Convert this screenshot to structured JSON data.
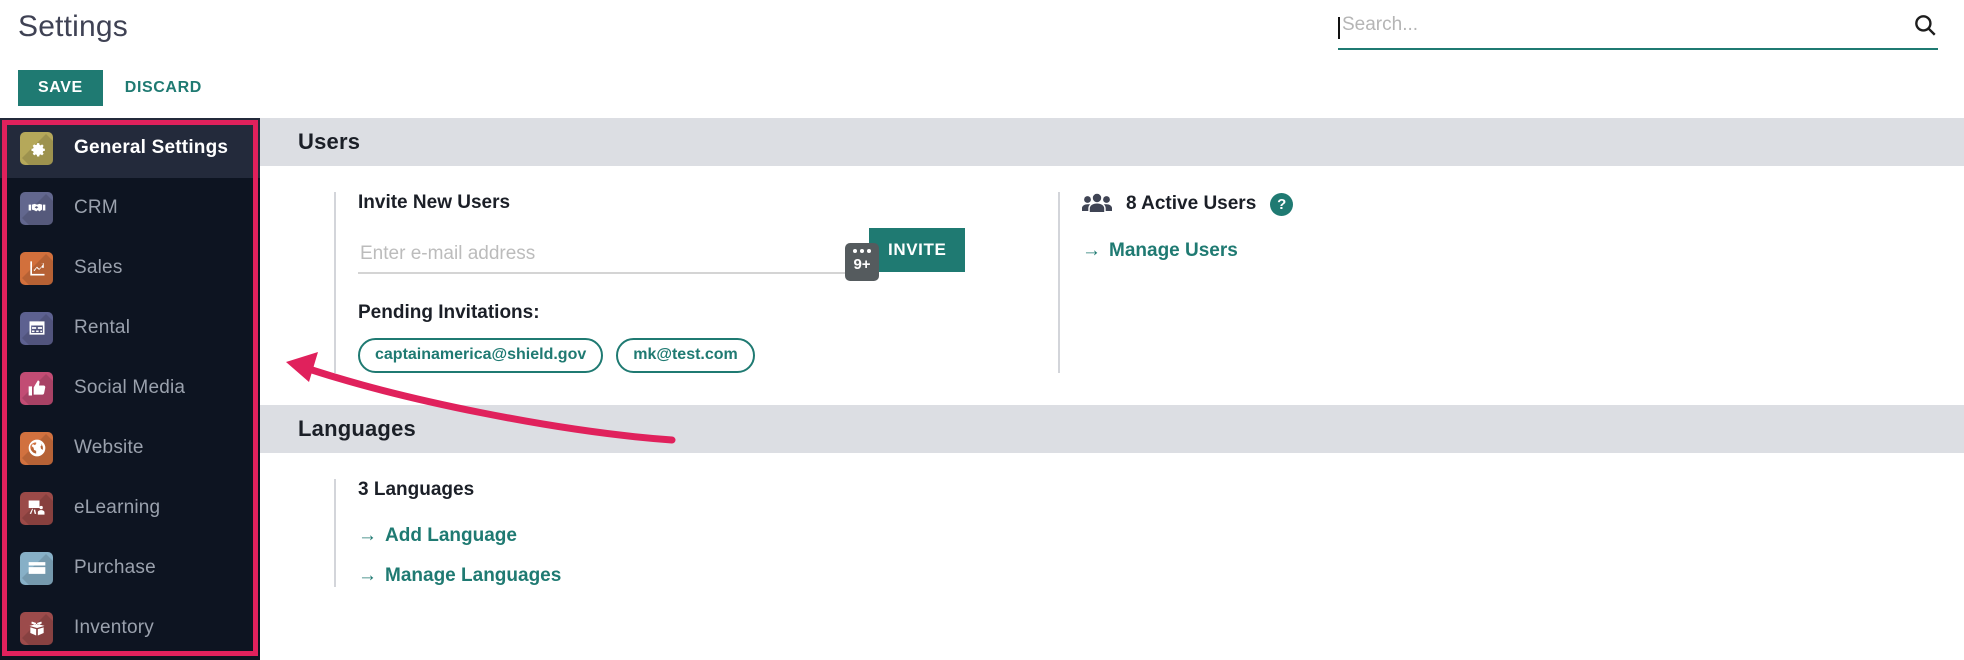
{
  "header": {
    "title": "Settings",
    "save_label": "SAVE",
    "discard_label": "DISCARD"
  },
  "search": {
    "placeholder": "Search...",
    "value": "",
    "icon": "search-icon"
  },
  "sidebar": {
    "items": [
      {
        "label": "General Settings",
        "icon": "gear-icon",
        "color": "#b5a85a",
        "active": true
      },
      {
        "label": "CRM",
        "icon": "handshake-icon",
        "color": "#62678e",
        "active": false
      },
      {
        "label": "Sales",
        "icon": "chart-up-icon",
        "color": "#d2703c",
        "active": false
      },
      {
        "label": "Rental",
        "icon": "calendar-icon",
        "color": "#5d6190",
        "active": false
      },
      {
        "label": "Social Media",
        "icon": "thumbs-up-icon",
        "color": "#c24c74",
        "active": false
      },
      {
        "label": "Website",
        "icon": "globe-icon",
        "color": "#d1713f",
        "active": false
      },
      {
        "label": "eLearning",
        "icon": "presenter-icon",
        "color": "#9b4a48",
        "active": false
      },
      {
        "label": "Purchase",
        "icon": "credit-card-icon",
        "color": "#87b0c7",
        "active": false
      },
      {
        "label": "Inventory",
        "icon": "open-box-icon",
        "color": "#9c4b4b",
        "active": false
      }
    ]
  },
  "users_section": {
    "title": "Users",
    "invite_label": "Invite New Users",
    "email_placeholder": "Enter e-mail address",
    "email_value": "",
    "invite_button": "INVITE",
    "pending_label": "Pending Invitations:",
    "pending": [
      "captainamerica@shield.gov",
      "mk@test.com"
    ],
    "active_users_text": "8 Active Users",
    "help_badge": "?",
    "manage_users_link": "Manage Users",
    "arrow_glyph": "→"
  },
  "languages_section": {
    "title": "Languages",
    "count_text": "3 Languages",
    "add_language_link": "Add Language",
    "manage_languages_link": "Manage Languages"
  },
  "cursor_badge": {
    "count": "9+"
  },
  "colors": {
    "accent_teal": "#1f7a72",
    "annotation_pink": "#e0215c",
    "sidebar_bg": "#0d1421",
    "section_bar": "#dcdee3"
  }
}
